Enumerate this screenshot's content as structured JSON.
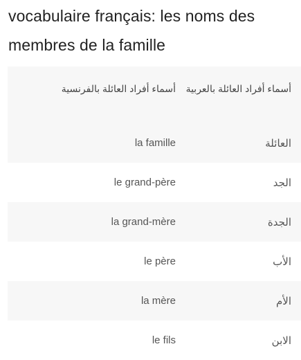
{
  "page": {
    "title": "vocabulaire français: les noms des membres de la famille"
  },
  "table": {
    "headers": {
      "arabic": "أسماء أفراد العائلة بالعربية",
      "french": "أسماء أفراد العائلة بالفرنسية"
    },
    "rows": [
      {
        "arabic": "العائلة",
        "french": "la famille"
      },
      {
        "arabic": "الجد",
        "french": "le grand-père"
      },
      {
        "arabic": "الجدة",
        "french": "la grand-mère"
      },
      {
        "arabic": "الأب",
        "french": "le père"
      },
      {
        "arabic": "الأم",
        "french": "la mère"
      },
      {
        "arabic": "الابن",
        "french": "le fils"
      }
    ]
  },
  "colors": {
    "stripe": "#f7f7f7",
    "text": "#555555",
    "title": "#222222"
  }
}
